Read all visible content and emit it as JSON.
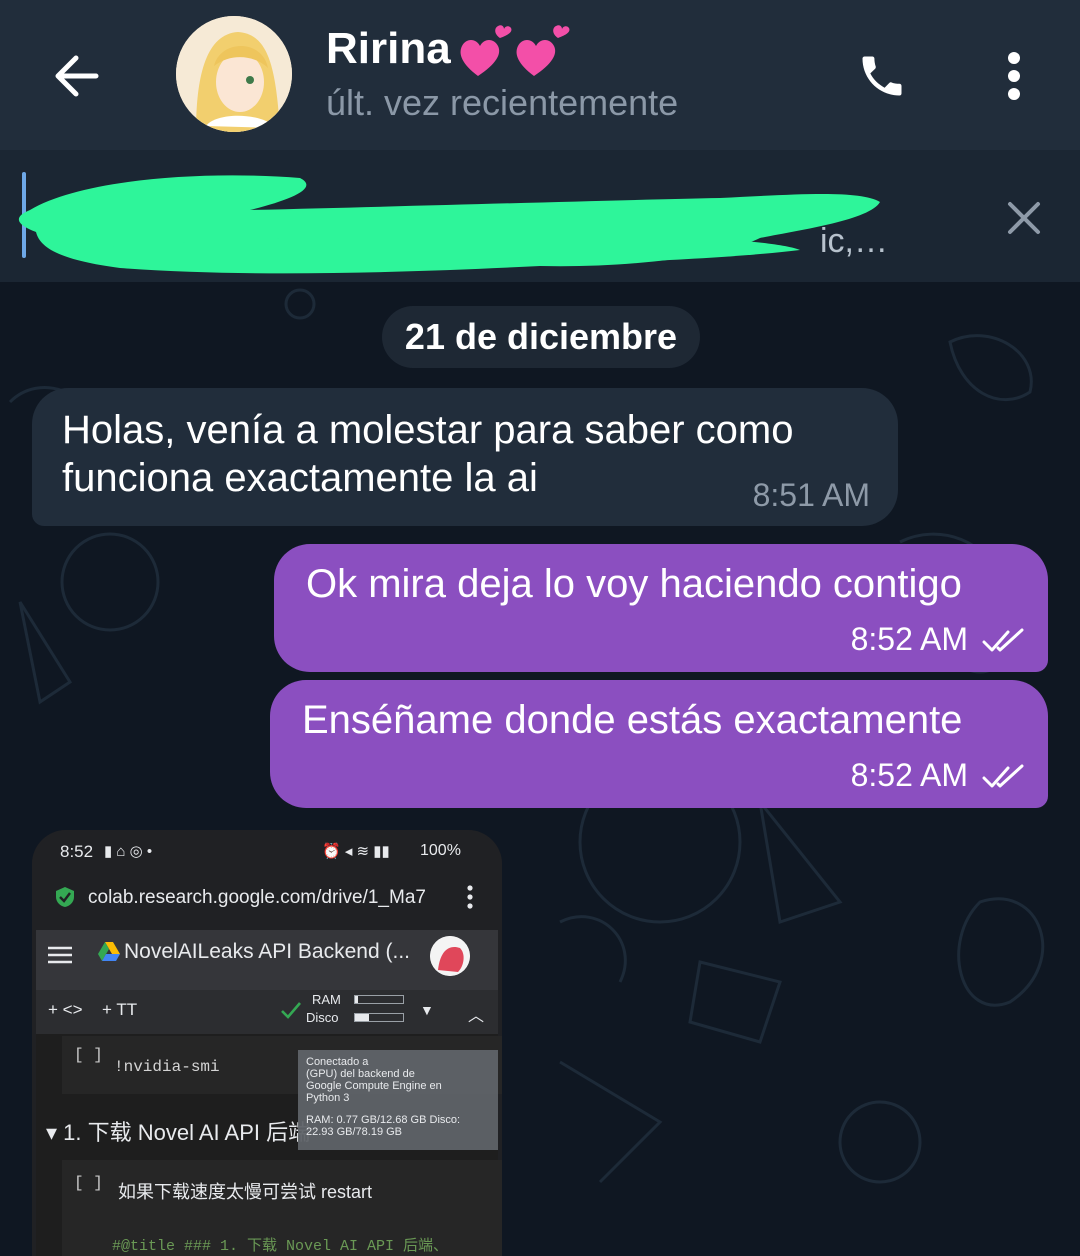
{
  "header": {
    "contact_name": "Ririna",
    "status": "últ. vez recientemente"
  },
  "pinned": {
    "preview": "ic,…"
  },
  "chat": {
    "date_chip": "21 de diciembre",
    "messages": [
      {
        "direction": "incoming",
        "text": "Holas, venía a molestar para saber como funciona exactamente la ai",
        "time": "8:51 AM"
      },
      {
        "direction": "outgoing",
        "text": "Ok mira deja lo voy haciendo contigo",
        "time": "8:52 AM",
        "read": true
      },
      {
        "direction": "outgoing",
        "text": "Enséñame donde estás exactamente",
        "time": "8:52 AM",
        "read": true
      }
    ]
  },
  "screenshot": {
    "status_time": "8:52",
    "battery": "100%",
    "url": "colab.research.google.com/drive/1_Ma7",
    "notebook_title": "NovelAILeaks API Backend (...",
    "toolbar_code": "+ <>",
    "toolbar_text": "+ TT",
    "ram_label": "RAM",
    "disk_label": "Disco",
    "ram_usage": 0.06,
    "disk_usage": 0.29,
    "cell1_bracket": "[ ]",
    "cell1_command": "!nvidia-smi",
    "section_heading": "1. 下载 Novel AI API 后端",
    "cell2_bracket": "[ ]",
    "cell2_title": "如果下载速度太慢可尝试 restart",
    "cell2_code": "#@title ### 1. 下载 Novel AI API 后端、",
    "tooltip_line1": "Conectado a",
    "tooltip_line2": "(GPU) del backend de",
    "tooltip_line3": "Google Compute Engine en",
    "tooltip_line4": "Python 3",
    "tooltip_line5": "RAM: 0.77 GB/12.68 GB Disco:",
    "tooltip_line6": "22.93 GB/78.19 GB"
  },
  "colors": {
    "header_bg": "#212d3b",
    "chat_bg": "#0f1722",
    "incoming_bubble": "#212d3b",
    "outgoing_bubble": "#8b4fc0",
    "redaction": "#2ef59a",
    "muted_text": "#8b98a7"
  },
  "icons": {
    "back": "arrow-left-icon",
    "call": "phone-icon",
    "menu": "more-vertical-icon",
    "pinned_close": "close-icon",
    "read_receipt": "double-check-icon"
  }
}
